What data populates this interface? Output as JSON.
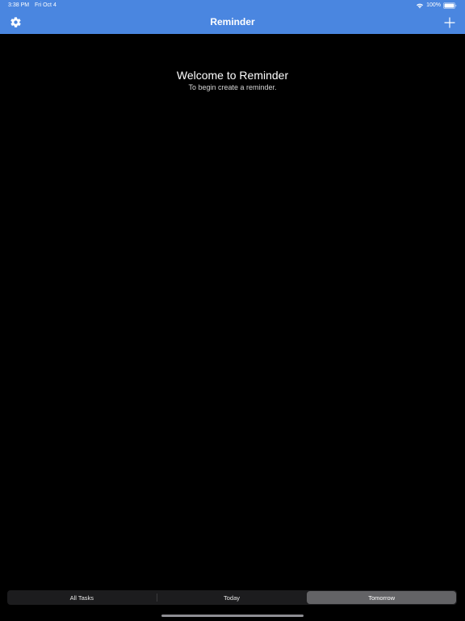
{
  "status_bar": {
    "time": "3:38 PM",
    "date": "Fri Oct 4",
    "battery": "100%",
    "icons": [
      "wifi-icon",
      "battery-icon"
    ]
  },
  "nav": {
    "title": "Reminder",
    "left_icon": "gear-icon",
    "right_icon": "plus-icon",
    "color": "#4a86e0"
  },
  "welcome": {
    "title": "Welcome to Reminder",
    "subtitle": "To begin create a reminder."
  },
  "segments": {
    "items": [
      {
        "label": "All Tasks"
      },
      {
        "label": "Today"
      },
      {
        "label": "Tomorrow"
      }
    ],
    "selected": "Tomorrow"
  }
}
